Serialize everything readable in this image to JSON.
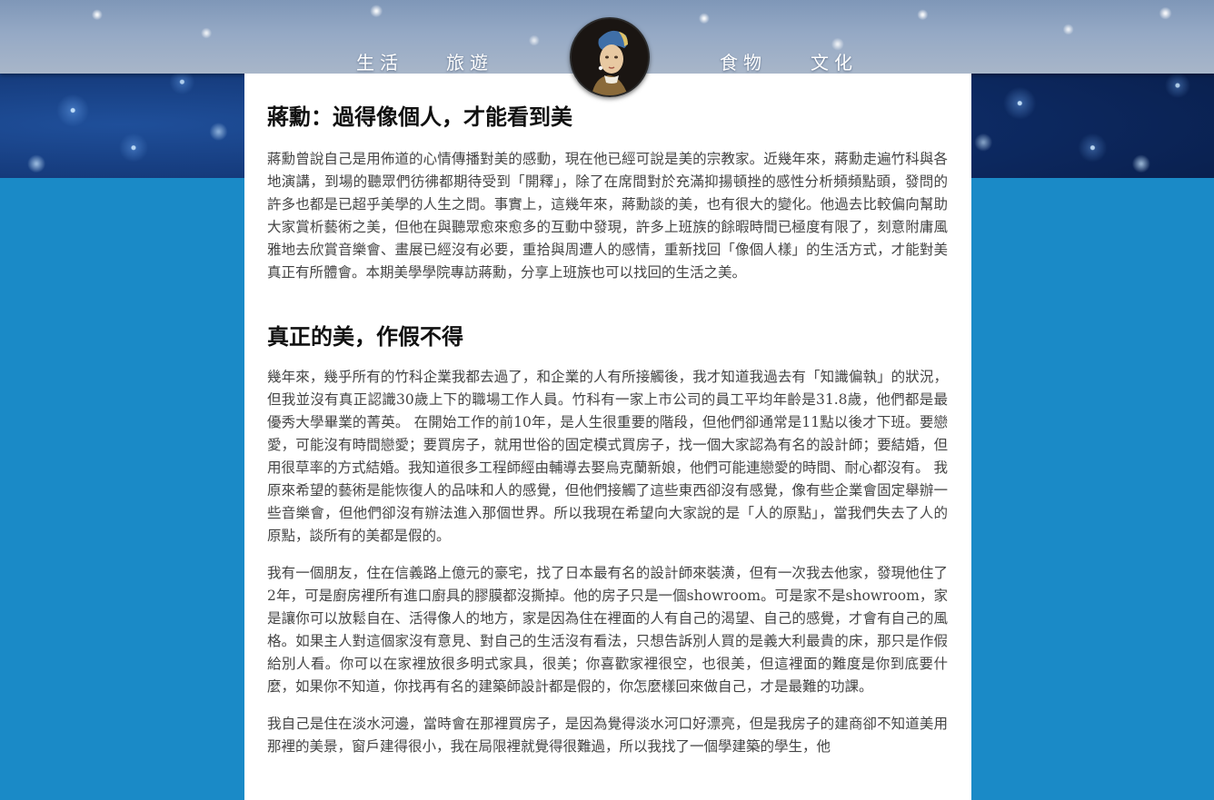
{
  "nav": {
    "items": [
      "生活",
      "旅遊",
      "食物",
      "文化"
    ]
  },
  "colors": {
    "page_background": "#1a8ac7",
    "content_background": "#ffffff",
    "heading": "#111111",
    "body_text": "#444444"
  },
  "logo": {
    "icon": "pearl-earring-portrait-icon"
  },
  "article": {
    "title": "蔣勳：過得像個人，才能看到美",
    "intro": "蔣勳曾說自己是用佈道的心情傳播對美的感動，現在他已經可說是美的宗教家。近幾年來，蔣勳走遍竹科與各地演講，到場的聽眾們彷彿都期待受到「開釋」，除了在席間對於充滿抑揚頓挫的感性分析頻頻點頭，發問的許多也都是已超乎美學的人生之問。事實上，這幾年來，蔣勳談的美，也有很大的變化。他過去比較偏向幫助大家賞析藝術之美，但他在與聽眾愈來愈多的互動中發現，許多上班族的餘暇時間已極度有限了，刻意附庸風雅地去欣賞音樂會、畫展已經沒有必要，重拾與周遭人的感情，重新找回「像個人樣」的生活方式，才能對美真正有所體會。本期美學學院專訪蔣勳，分享上班族也可以找回的生活之美。",
    "section_title": "真正的美，作假不得",
    "paragraphs": [
      "幾年來，幾乎所有的竹科企業我都去過了，和企業的人有所接觸後，我才知道我過去有「知識偏執」的狀況，但我並沒有真正認識30歲上下的職場工作人員。竹科有一家上市公司的員工平均年齡是31.8歲，他們都是最優秀大學畢業的菁英。 在開始工作的前10年，是人生很重要的階段，但他們卻通常是11點以後才下班。要戀愛，可能沒有時間戀愛；要買房子，就用世俗的固定模式買房子，找一個大家認為有名的設計師；要結婚，但用很草率的方式結婚。我知道很多工程師經由輔導去娶烏克蘭新娘，他們可能連戀愛的時間、耐心都沒有。 我原來希望的藝術是能恢復人的品味和人的感覺，但他們接觸了這些東西卻沒有感覺，像有些企業會固定舉辦一些音樂會，但他們卻沒有辦法進入那個世界。所以我現在希望向大家說的是「人的原點」，當我們失去了人的原點，談所有的美都是假的。",
      "我有一個朋友，住在信義路上億元的豪宅，找了日本最有名的設計師來裝潢，但有一次我去他家，發現他住了2年，可是廚房裡所有進口廚具的膠膜都沒撕掉。他的房子只是一個showroom。可是家不是showroom，家是讓你可以放鬆自在、活得像人的地方，家是因為住在裡面的人有自己的渴望、自己的感覺，才會有自己的風格。如果主人對這個家沒有意見、對自己的生活沒有看法，只想告訴別人買的是義大利最貴的床，那只是作假給別人看。你可以在家裡放很多明式家具，很美；你喜歡家裡很空，也很美，但這裡面的難度是你到底要什麼，如果你不知道，你找再有名的建築師設計都是假的，你怎麼樣回來做自己，才是最難的功課。",
      "我自己是住在淡水河邊，當時會在那裡買房子，是因為覺得淡水河口好漂亮，但是我房子的建商卻不知道美用那裡的美景，窗戶建得很小，我在局限裡就覺得很難過，所以我找了一個學建築的學生，他"
    ]
  }
}
